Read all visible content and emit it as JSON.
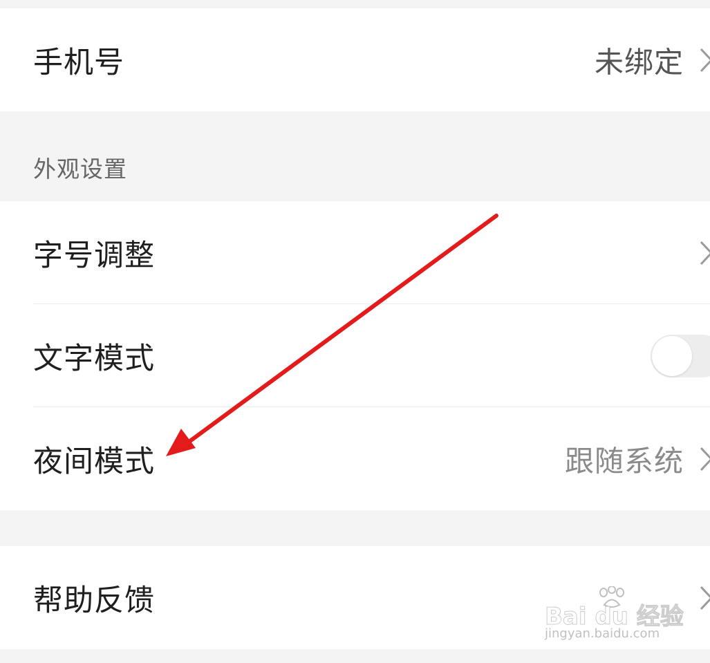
{
  "account": {
    "phone_label": "手机号",
    "phone_value": "未绑定"
  },
  "appearance": {
    "section_title": "外观设置",
    "font_size_label": "字号调整",
    "text_mode_label": "文字模式",
    "text_mode_enabled": false,
    "night_mode_label": "夜间模式",
    "night_mode_value": "跟随系统"
  },
  "support": {
    "feedback_label": "帮助反馈"
  },
  "annotation": {
    "arrow_color": "#e31b1b",
    "points_to": "night-mode-row"
  },
  "watermark": {
    "brand": "Bai du 经验",
    "url": "jingyan.baidu.com"
  },
  "icons": {
    "chevron": "chevron-right-icon"
  }
}
